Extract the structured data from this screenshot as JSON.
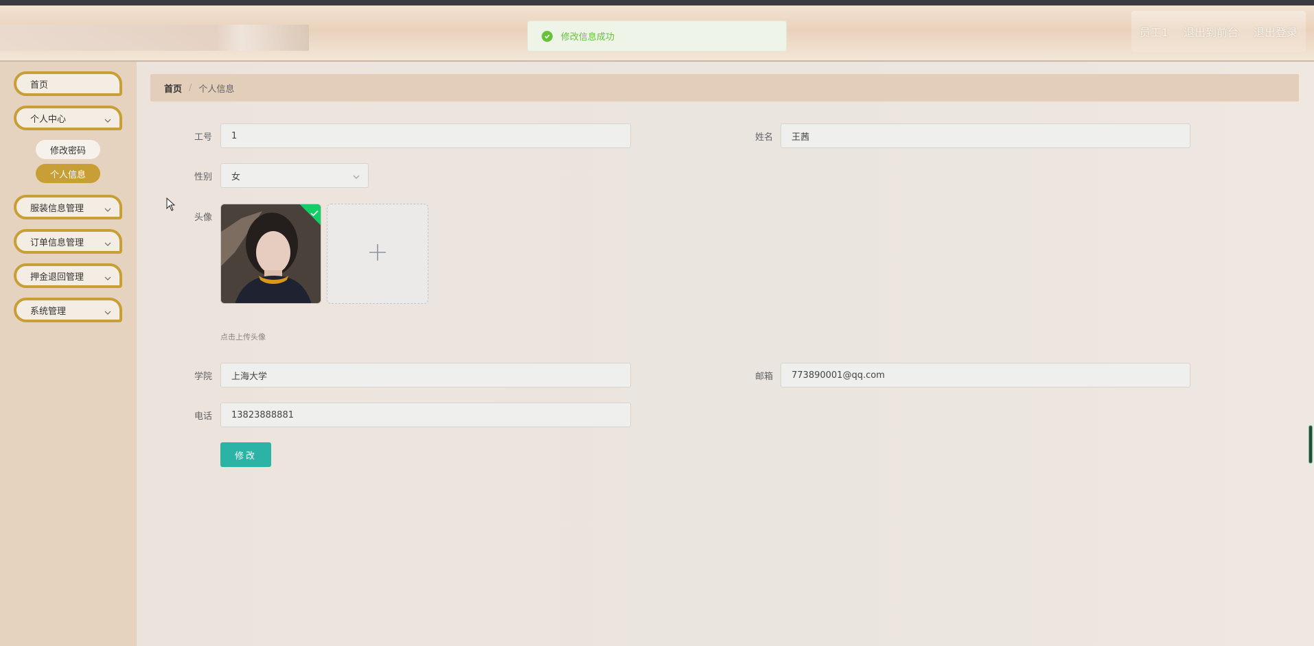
{
  "header": {
    "user_label": "员工1",
    "front_label": "退出到前台",
    "logout_label": "退出登录"
  },
  "toast": {
    "message": "修改信息成功",
    "icon": "check-circle-icon"
  },
  "sidebar": {
    "items": [
      {
        "label": "首页"
      },
      {
        "label": "个人中心",
        "sub": [
          {
            "label": "修改密码"
          },
          {
            "label": "个人信息"
          }
        ]
      },
      {
        "label": "服装信息管理"
      },
      {
        "label": "订单信息管理"
      },
      {
        "label": "押金退回管理"
      },
      {
        "label": "系统管理"
      }
    ]
  },
  "breadcrumb": {
    "home": "首页",
    "sep": "/",
    "current": "个人信息"
  },
  "form": {
    "employee_no": {
      "label": "工号",
      "value": "1"
    },
    "name": {
      "label": "姓名",
      "value": "王茜"
    },
    "gender": {
      "label": "性别",
      "value": "女"
    },
    "avatar": {
      "label": "头像",
      "hint": "点击上传头像"
    },
    "college": {
      "label": "学院",
      "value": "上海大学"
    },
    "email": {
      "label": "邮箱",
      "value": "773890001@qq.com"
    },
    "phone": {
      "label": "电话",
      "value": "13823888881"
    },
    "submit_label": "修改"
  },
  "colors": {
    "accent_gold": "#c89f36",
    "submit_teal": "#2bb3a6",
    "success_green": "#67c23a"
  }
}
